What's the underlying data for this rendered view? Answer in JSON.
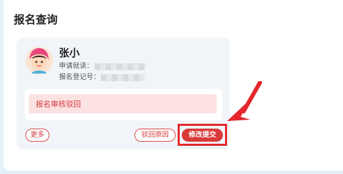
{
  "section": {
    "title": "报名查询"
  },
  "card": {
    "name": "张小",
    "apply_school_label": "申请就读：",
    "registration_no_label": "报名登记号：",
    "notice": "报名审核驳回",
    "actions": {
      "more": "更多",
      "reject_reason": "驳回原因",
      "modify_submit": "修改提交"
    }
  },
  "colors": {
    "accent_red": "#d83a3a",
    "highlight_red": "#e5262c",
    "notice_bg": "#fde2e2",
    "card_bg": "#f1f4f8",
    "page_bg": "#e3f1fa"
  },
  "icons": {
    "avatar": "child-avatar-icon",
    "pointer": "red-arrow-icon"
  }
}
